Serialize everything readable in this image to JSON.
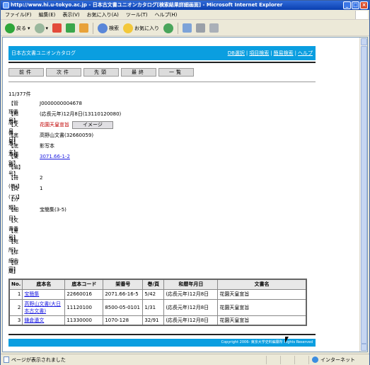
{
  "window": {
    "title": "http://www.hi.u-tokyo.ac.jp - 日本古文書ユニオンカタログ[検索結果詳細画面] - Microsoft Internet Explorer"
  },
  "menu": [
    "ファイル(F)",
    "編集(E)",
    "表示(V)",
    "お気に入り(A)",
    "ツール(T)",
    "ヘルプ(H)"
  ],
  "toolbar": {
    "back": "戻る",
    "search": "検索",
    "favorites": "お気に入り"
  },
  "header": {
    "site_title": "日本古文書ユニオンカタログ",
    "links": [
      "DB選択",
      "項目検索",
      "簡易検索",
      "ヘルプ"
    ]
  },
  "nav_buttons": [
    "前件",
    "次件",
    "先頭",
    "最終",
    "一覧"
  ],
  "record_count": "11/377件",
  "record": [
    {
      "label": "【管理番号】",
      "value": "J0000000004678"
    },
    {
      "label": "【和暦年月日】",
      "value": "(応長元年)12月8日(13110120080)"
    },
    {
      "label": "【文書名】",
      "value": "花園天皇宣旨",
      "image_button": "イメージ"
    },
    {
      "label": "【底本名】",
      "value": "高野山文書(32660059)"
    },
    {
      "label": "【底本種別】",
      "value": "影写本"
    },
    {
      "label": "【架番号】",
      "value": "3071.66-1-2",
      "link": true
    },
    {
      "label": "【編】",
      "value": ""
    },
    {
      "label": "【冊(巻)】",
      "value": "2"
    },
    {
      "label": "【頁(丁)】",
      "value": "1"
    },
    {
      "label": "【分類】",
      "value": ""
    },
    {
      "label": "【細目】",
      "value": "宝簡集(3-5)"
    },
    {
      "label": "【文書番号】",
      "value": ""
    },
    {
      "label": "【差出】",
      "value": ""
    },
    {
      "label": "【宛所】",
      "value": ""
    },
    {
      "label": "【詳細内容】",
      "value": ""
    },
    {
      "label": "【原蔵】",
      "value": ""
    }
  ],
  "table": {
    "headers": [
      "No.",
      "底本名",
      "底本コード",
      "架番号",
      "巻/頁",
      "和暦年月日",
      "文書名"
    ],
    "rows": [
      [
        "1",
        "宝簡集",
        "22660016",
        "2071.66-16-5",
        "5/42",
        "(応長元年)12月8日",
        "花園天皇宣旨"
      ],
      [
        "2",
        "高野山文書(大日本古文書)",
        "11120100",
        "8500-05-0101",
        "1/31",
        "(応長元年)12月8日",
        "花園天皇宣旨"
      ],
      [
        "3",
        "鎌倉遺文",
        "11330000",
        "1070-128",
        "32/91",
        "(応長元年)12月8日",
        "花園天皇宣旨"
      ]
    ]
  },
  "footer": {
    "copyright": "Copyright 2006- 東京大学史料編纂所 Rights Reserved"
  },
  "status": {
    "message": "ページが表示されました",
    "zone": "インターネット"
  }
}
